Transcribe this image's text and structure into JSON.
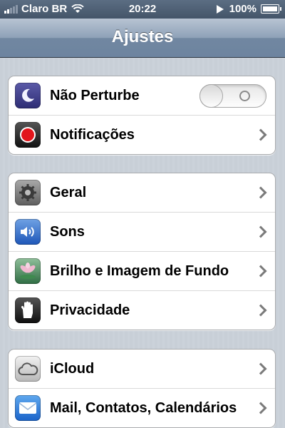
{
  "status_bar": {
    "carrier": "Claro BR",
    "time": "20:22",
    "battery": "100%",
    "signal_bars": 2
  },
  "nav": {
    "title": "Ajustes"
  },
  "groups": [
    {
      "rows": [
        {
          "label": "Não Perturbe",
          "icon": "moon-icon",
          "control": "toggle",
          "toggle_on": false
        },
        {
          "label": "Notificações",
          "icon": "notifications-icon",
          "control": "chevron"
        }
      ]
    },
    {
      "rows": [
        {
          "label": "Geral",
          "icon": "gear-icon",
          "control": "chevron"
        },
        {
          "label": "Sons",
          "icon": "speaker-icon",
          "control": "chevron"
        },
        {
          "label": "Brilho e Imagem de Fundo",
          "icon": "flower-icon",
          "control": "chevron"
        },
        {
          "label": "Privacidade",
          "icon": "hand-icon",
          "control": "chevron"
        }
      ]
    },
    {
      "rows": [
        {
          "label": "iCloud",
          "icon": "cloud-icon",
          "control": "chevron"
        },
        {
          "label": "Mail, Contatos, Calendários",
          "icon": "mail-icon",
          "control": "chevron"
        }
      ]
    }
  ],
  "colors": {
    "nav_bar": "#7187a1",
    "background": "#c5ccd4",
    "chevron": "#7b7b7b"
  }
}
